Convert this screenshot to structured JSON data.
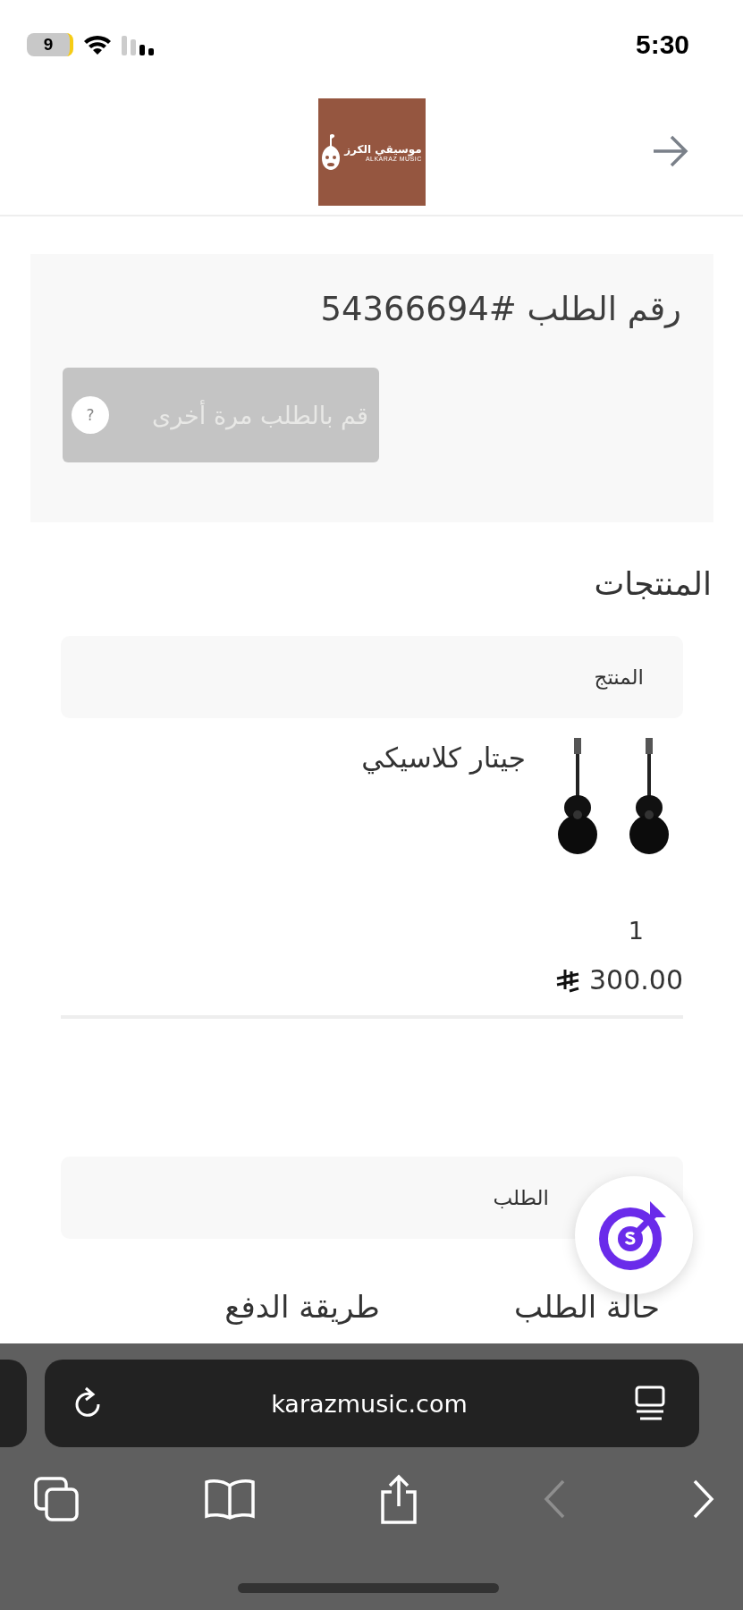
{
  "status_bar": {
    "time": "5:30",
    "battery": "9"
  },
  "header": {
    "logo_arabic": "موسيقي الكرز",
    "logo_latin": "ALKARAZ MUSIC"
  },
  "order": {
    "title": "رقم الطلب #54366694",
    "reorder_button": {
      "label": "قم بالطلب مرة أخرى",
      "disabled": true,
      "help": "?"
    }
  },
  "products": {
    "heading": "المنتجات",
    "column_header": "المنتج",
    "items": [
      {
        "name": "جيتار كلاسيكي",
        "quantity": "1",
        "price": "300.00"
      }
    ]
  },
  "order_details": {
    "column_header": "الطلب",
    "labels": [
      "حالة الطلب",
      "طريقة الدفع"
    ]
  },
  "browser": {
    "url": "karazmusic.com"
  }
}
